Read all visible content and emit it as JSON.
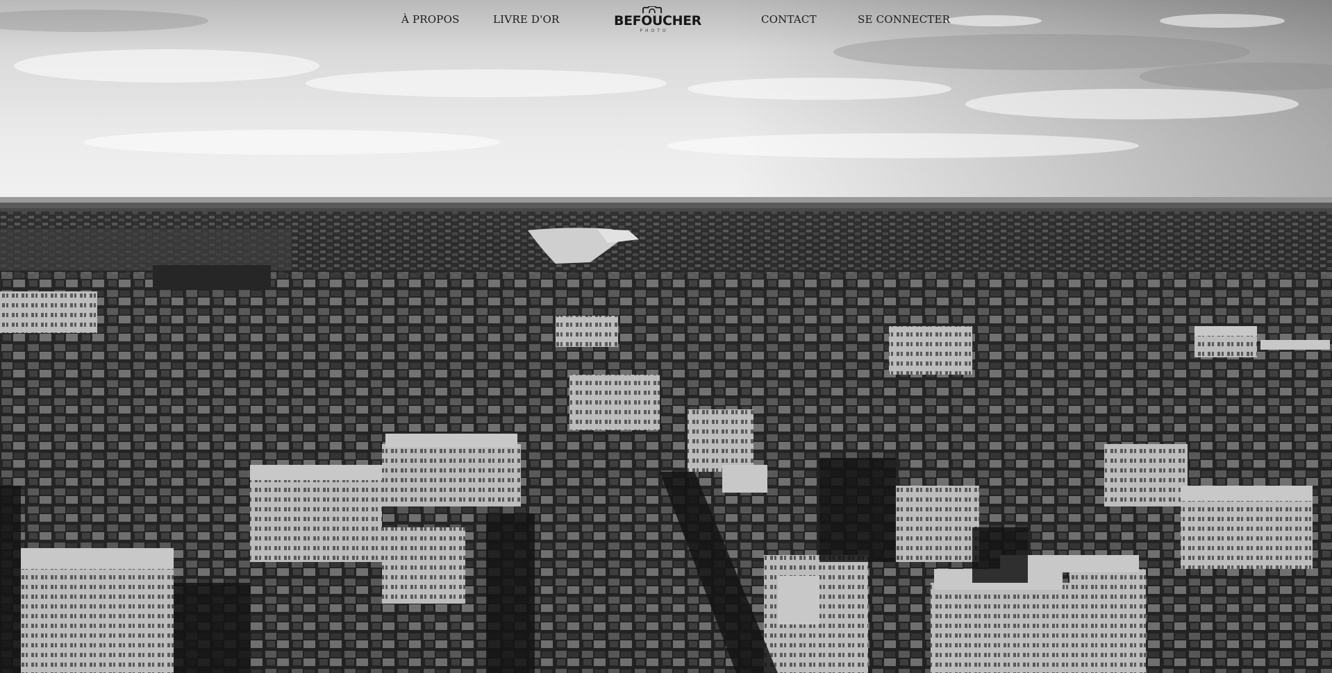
{
  "nav": {
    "left": [
      {
        "label": "À PROPOS"
      },
      {
        "label": "LIVRE D'OR"
      }
    ],
    "right": [
      {
        "label": "CONTACT"
      },
      {
        "label": "SE CONNECTER"
      }
    ]
  },
  "logo": {
    "name": "BEFOUCHER",
    "subtitle": "PHOTO",
    "icon": "camera-icon"
  },
  "hero": {
    "style": "grayscale",
    "subject": "aerial-city-icon"
  },
  "colors": {
    "nav_text": "#1b1b1b",
    "sky_light": "#e6e6e6",
    "sky_dark": "#8c8c8c",
    "city_dark": "#1e1e1e",
    "river": "#d2d2d2"
  }
}
